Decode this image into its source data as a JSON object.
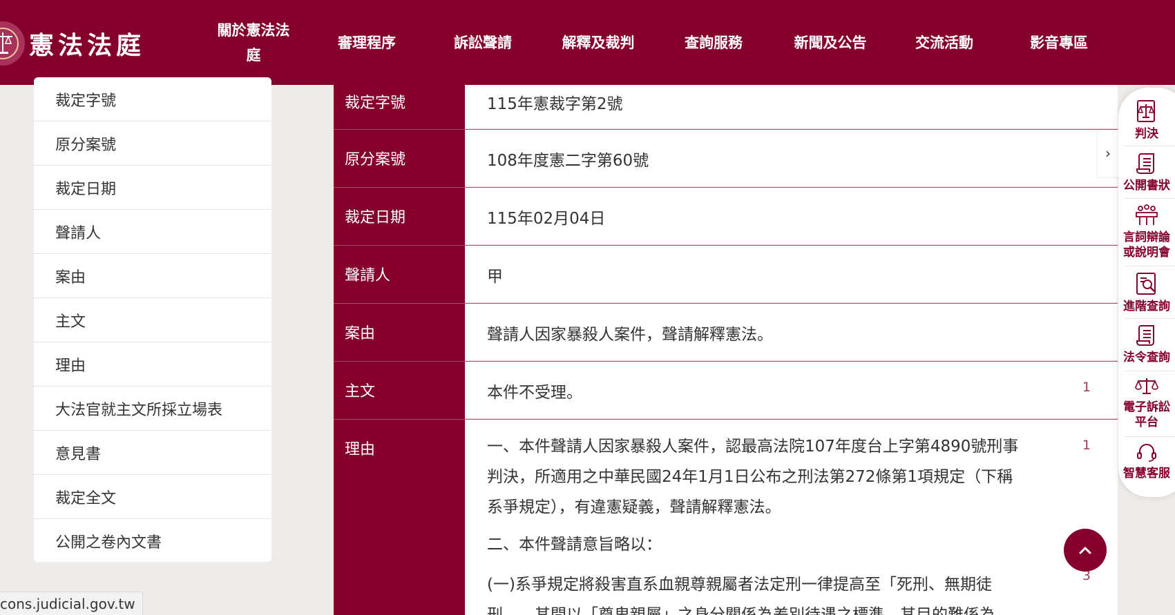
{
  "header": {
    "logo_text": "憲法法庭",
    "nav": [
      {
        "label": "關於憲法法庭"
      },
      {
        "label": "審理程序"
      },
      {
        "label": "訴訟聲請"
      },
      {
        "label": "解釋及裁判"
      },
      {
        "label": "查詢服務"
      },
      {
        "label": "新聞及公告"
      },
      {
        "label": "交流活動"
      },
      {
        "label": "影音專區"
      }
    ],
    "nav_first_line1": "關於憲法法",
    "nav_first_line2": "庭"
  },
  "sidebar": {
    "items": [
      {
        "label": "裁定字號"
      },
      {
        "label": "原分案號"
      },
      {
        "label": "裁定日期"
      },
      {
        "label": "聲請人"
      },
      {
        "label": "案由"
      },
      {
        "label": "主文"
      },
      {
        "label": "理由"
      },
      {
        "label": "大法官就主文所採立場表"
      },
      {
        "label": "意見書"
      },
      {
        "label": "裁定全文"
      },
      {
        "label": "公開之卷內文書"
      }
    ]
  },
  "detail": {
    "rows": [
      {
        "label": "裁定字號",
        "value": "115年憲裁字第2號"
      },
      {
        "label": "原分案號",
        "value": "108年度憲二字第60號"
      },
      {
        "label": "裁定日期",
        "value": "115年02月04日"
      },
      {
        "label": "聲請人",
        "value": "甲"
      },
      {
        "label": "案由",
        "value": "聲請人因家暴殺人案件，聲請解釋憲法。"
      },
      {
        "label": "主文",
        "value": "本件不受理。",
        "para_num": "1"
      },
      {
        "label": "理由"
      }
    ],
    "reason": {
      "p1_line1": "一、本件聲請人因家暴殺人案件，認最高法院107年度台上字第4890號刑事",
      "p1_line2": "判決，所適用之中華民國24年1月1日公布之刑法第272條第1項規定（下稱",
      "p1_line3": "系爭規定），有違憲疑義，聲請解釋憲法。",
      "p1_num": "1",
      "p2": "二、本件聲請意旨略以：",
      "p3_line1": "(一)系爭規定將殺害直系血親尊親屬者法定刑一律提高至「死刑、無期徒",
      "p3_line2": "刑……其問以「尊卑親屬」之身分關係為差別待遇之標準，其目的難係為",
      "p3_num": "3"
    }
  },
  "right_panel": {
    "items": [
      {
        "label": "判決",
        "icon": "judgment-scales-icon"
      },
      {
        "label": "公開書狀",
        "icon": "scroll-document-icon"
      },
      {
        "label_line1": "言詞辯論",
        "label_line2": "或說明會",
        "icon": "court-hearing-icon"
      },
      {
        "label": "進階查詢",
        "icon": "advanced-search-icon"
      },
      {
        "label": "法令查詢",
        "icon": "law-scroll-icon"
      },
      {
        "label_line1": "電子訴訟",
        "label_line2": "平台",
        "icon": "e-litigation-scales-icon"
      },
      {
        "label": "智慧客服",
        "icon": "headset-icon"
      }
    ]
  },
  "status_bar": {
    "url": "cons.judicial.gov.tw"
  }
}
